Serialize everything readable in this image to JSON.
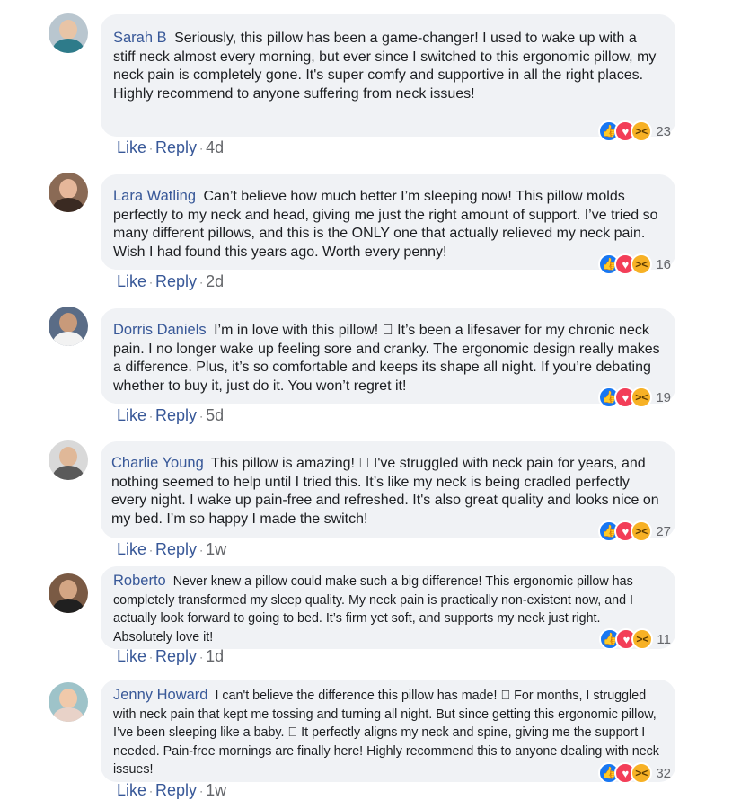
{
  "comments": [
    {
      "author": "Sarah B",
      "text": "Seriously, this pillow has been a game-changer! I used to wake up with a stiff neck almost every morning, but ever since I switched to this ergonomic pillow, my neck pain is completely gone. It's super comfy and supportive in all the right places. Highly recommend to anyone suffering from neck issues!",
      "reaction_count": "23",
      "like": "Like",
      "reply": "Reply",
      "time": "4d",
      "avatar_colors": {
        "bg": "#b9c6cf",
        "skin": "#e8c4a6",
        "body": "#2e7b8a"
      }
    },
    {
      "author": "Lara Watling",
      "text": "Can’t believe how much better I’m sleeping now! This pillow molds perfectly to my neck and head, giving me just the right amount of support. I’ve tried so many different pillows, and this is the ONLY one that actually relieved my neck pain. Wish I had found this years ago. Worth every penny!",
      "reaction_count": "16",
      "like": "Like",
      "reply": "Reply",
      "time": "2d",
      "avatar_colors": {
        "bg": "#8a6a55",
        "skin": "#e6b79a",
        "body": "#3a2a22"
      }
    },
    {
      "author": "Dorris Daniels",
      "text": "I’m in love with this pillow! \u0000 It’s been a lifesaver for my chronic neck pain. I no longer wake up feeling sore and cranky. The ergonomic design really makes a difference. Plus, it’s so comfortable and keeps its shape all night. If you’re debating whether to buy it, just do it. You won’t regret it!",
      "reaction_count": "19",
      "like": "Like",
      "reply": "Reply",
      "time": "5d",
      "avatar_colors": {
        "bg": "#5a6c86",
        "skin": "#c89a7a",
        "body": "#f2f2f2"
      }
    },
    {
      "author": "Charlie Young",
      "text": "This pillow is amazing! \u0000 I've struggled with neck pain for years, and nothing seemed to help until I tried this. It’s like my neck is being cradled perfectly every night. I wake up pain-free and refreshed. It's also great quality and looks nice on my bed. I’m so happy I made the switch!",
      "reaction_count": "27",
      "like": "Like",
      "reply": "Reply",
      "time": "1w",
      "avatar_colors": {
        "bg": "#d9d9d9",
        "skin": "#e0b898",
        "body": "#5a5a5a"
      }
    },
    {
      "author": "Roberto",
      "text": "Never knew a pillow could make such a big difference! This ergonomic pillow has completely transformed my sleep quality. My neck pain is practically non-existent now, and I actually look forward to going to bed. It’s firm yet soft, and supports my neck just right. Absolutely love it!",
      "reaction_count": "11",
      "like": "Like",
      "reply": "Reply",
      "time": "1d",
      "avatar_colors": {
        "bg": "#7a5a44",
        "skin": "#d4a684",
        "body": "#202020"
      }
    },
    {
      "author": "Jenny Howard",
      "text": "I can't believe the difference this pillow has made! \u0000 For months, I struggled with neck pain that kept me tossing and turning all night. But since getting this ergonomic pillow, I’ve been sleeping like a baby. \u0000 It perfectly aligns my neck and spine, giving me the support I needed. Pain-free mornings are finally here! Highly recommend this to anyone dealing with neck issues!",
      "reaction_count": "32",
      "like": "Like",
      "reply": "Reply",
      "time": "1w",
      "avatar_colors": {
        "bg": "#9ec3c9",
        "skin": "#f0c9aa",
        "body": "#e8d2c8"
      }
    }
  ],
  "reaction_icons": [
    "like-icon",
    "love-icon",
    "haha-icon"
  ],
  "colors": {
    "author": "#385898",
    "bubble": "#f0f2f5",
    "meta": "#65676b",
    "like_reaction": "#1877f2",
    "love_reaction": "#f33e58",
    "haha_reaction": "#f7b125"
  }
}
